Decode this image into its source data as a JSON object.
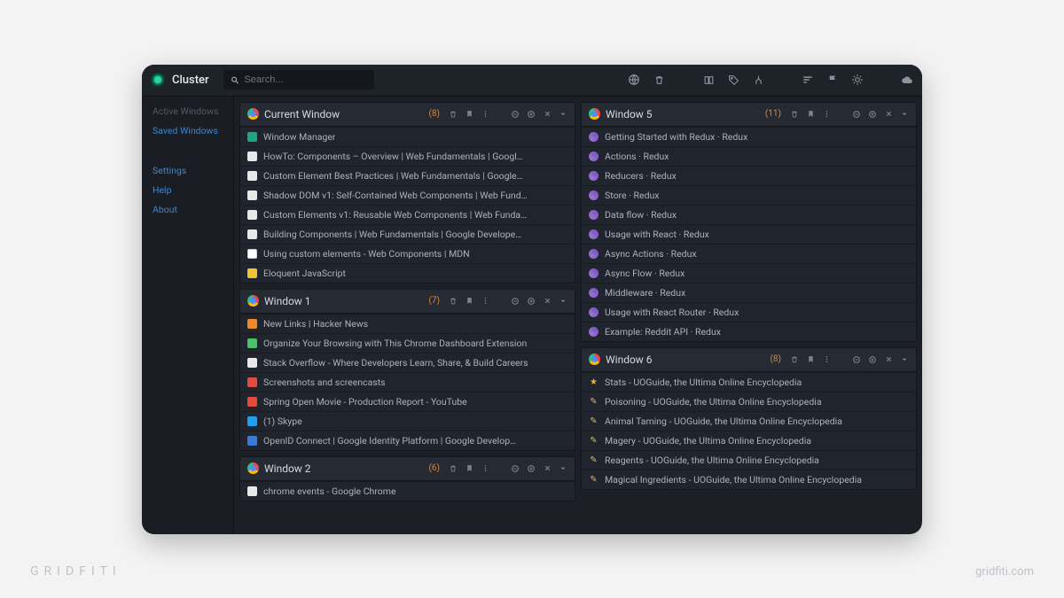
{
  "app": {
    "title": "Cluster"
  },
  "search": {
    "placeholder": "Search..."
  },
  "sidebar": {
    "items": [
      {
        "label": "Active Windows",
        "muted": true
      },
      {
        "label": "Saved Windows",
        "muted": false
      }
    ],
    "secondary": [
      {
        "label": "Settings"
      },
      {
        "label": "Help"
      },
      {
        "label": "About"
      }
    ]
  },
  "columns": [
    {
      "windows": [
        {
          "title": "Current Window",
          "count": "(8)",
          "tabs": [
            {
              "fav": "teal",
              "title": "Window Manager"
            },
            {
              "fav": "white",
              "title": "HowTo: Components – Overview | Web Fundamentals | Googl…"
            },
            {
              "fav": "white",
              "title": "Custom Element Best Practices | Web Fundamentals | Google…"
            },
            {
              "fav": "white",
              "title": "Shadow DOM v1: Self-Contained Web Components | Web Fund…"
            },
            {
              "fav": "white",
              "title": "Custom Elements v1: Reusable Web Components | Web Funda…"
            },
            {
              "fav": "white",
              "title": "Building Components | Web Fundamentals | Google Develope…"
            },
            {
              "fav": "whitebox",
              "title": "Using custom elements - Web Components | MDN"
            },
            {
              "fav": "yellow",
              "title": "Eloquent JavaScript"
            }
          ]
        },
        {
          "title": "Window 1",
          "count": "(7)",
          "tabs": [
            {
              "fav": "orange",
              "title": "New Links | Hacker News"
            },
            {
              "fav": "green",
              "title": "Organize Your Browsing with This Chrome Dashboard Extension"
            },
            {
              "fav": "white",
              "title": "Stack Overflow - Where Developers Learn, Share, & Build Careers"
            },
            {
              "fav": "red",
              "title": "Screenshots and screencasts"
            },
            {
              "fav": "red",
              "title": "Spring Open Movie - Production Report - YouTube"
            },
            {
              "fav": "skype",
              "title": "(1) Skype"
            },
            {
              "fav": "blue",
              "title": "OpenID Connect | Google Identity Platform | Google Develop…"
            }
          ]
        },
        {
          "title": "Window 2",
          "count": "(6)",
          "tabs": [
            {
              "fav": "white",
              "title": "chrome events - Google Chrome"
            }
          ]
        }
      ]
    },
    {
      "windows": [
        {
          "title": "Window 5",
          "count": "(11)",
          "tabs": [
            {
              "fav": "purple",
              "title": "Getting Started with Redux · Redux"
            },
            {
              "fav": "purple",
              "title": "Actions · Redux"
            },
            {
              "fav": "purple",
              "title": "Reducers · Redux"
            },
            {
              "fav": "purple",
              "title": "Store · Redux"
            },
            {
              "fav": "purple",
              "title": "Data flow · Redux"
            },
            {
              "fav": "purple",
              "title": "Usage with React · Redux"
            },
            {
              "fav": "purple",
              "title": "Async Actions · Redux"
            },
            {
              "fav": "purple",
              "title": "Async Flow · Redux"
            },
            {
              "fav": "purple",
              "title": "Middleware · Redux"
            },
            {
              "fav": "purple",
              "title": "Usage with React Router · Redux"
            },
            {
              "fav": "purple",
              "title": "Example: Reddit API · Redux"
            }
          ]
        },
        {
          "title": "Window 6",
          "count": "(8)",
          "tabs": [
            {
              "fav": "star",
              "title": "Stats - UOGuide, the Ultima Online Encyclopedia"
            },
            {
              "fav": "wand",
              "title": "Poisoning - UOGuide, the Ultima Online Encyclopedia"
            },
            {
              "fav": "wand",
              "title": "Animal Taming - UOGuide, the Ultima Online Encyclopedia"
            },
            {
              "fav": "wand",
              "title": "Magery - UOGuide, the Ultima Online Encyclopedia"
            },
            {
              "fav": "wand",
              "title": "Reagents - UOGuide, the Ultima Online Encyclopedia"
            },
            {
              "fav": "wand",
              "title": "Magical Ingredients - UOGuide, the Ultima Online Encyclopedia"
            }
          ]
        }
      ]
    }
  ],
  "watermark": {
    "left": "GRIDFITI",
    "right": "gridfiti.com"
  }
}
